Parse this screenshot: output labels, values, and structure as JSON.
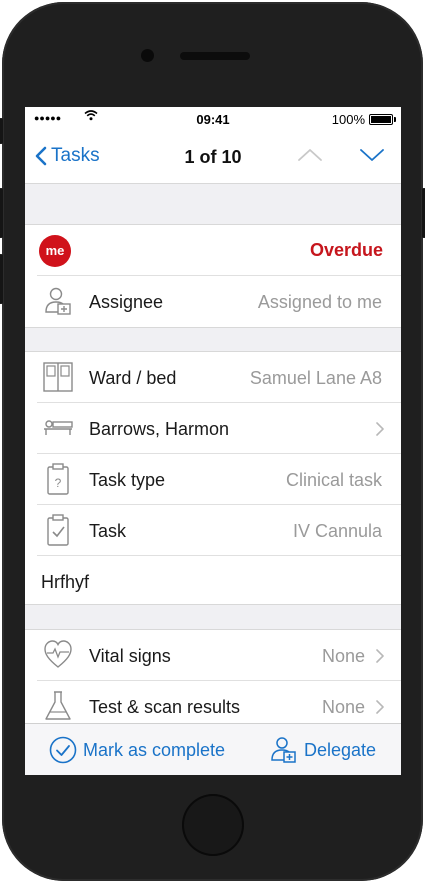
{
  "status_bar": {
    "signal": "●●●●●",
    "time": "09:41",
    "battery": "100%"
  },
  "nav": {
    "back_label": "Tasks",
    "title": "1 of 10"
  },
  "task": {
    "badge": "me",
    "status": "Overdue",
    "assignee_label": "Assignee",
    "assignee_value": "Assigned to me"
  },
  "details": {
    "ward_label": "Ward / bed",
    "ward_value": "Samuel Lane A8",
    "patient_name": "Barrows, Harmon",
    "type_label": "Task type",
    "type_value": "Clinical task",
    "task_label": "Task",
    "task_value": "IV Cannula",
    "note": "Hrfhyf"
  },
  "results": {
    "vitals_label": "Vital signs",
    "vitals_value": "None",
    "tests_label": "Test & scan results",
    "tests_value": "None"
  },
  "toolbar": {
    "complete_label": "Mark as complete",
    "delegate_label": "Delegate"
  },
  "colors": {
    "accent": "#1a73c8",
    "alert": "#c6161d",
    "badge": "#d0121b",
    "icon_gray": "#8a8a8a"
  }
}
